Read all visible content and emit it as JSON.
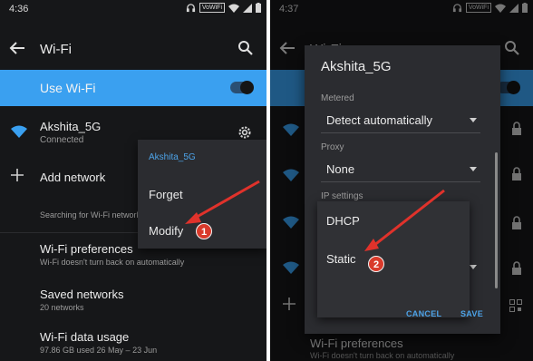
{
  "left": {
    "status": {
      "time": "4:36",
      "badge": "VoWiFi"
    },
    "appbar": {
      "title": "Wi-Fi"
    },
    "use_wifi": {
      "label": "Use Wi-Fi"
    },
    "network": {
      "name": "Akshita_5G",
      "status": "Connected"
    },
    "add_network": {
      "label": "Add network"
    },
    "searching": {
      "text": "Searching for Wi-Fi network"
    },
    "prefs": [
      {
        "title": "Wi-Fi preferences",
        "subtitle": "Wi-Fi doesn't turn back on automatically"
      },
      {
        "title": "Saved networks",
        "subtitle": "20 networks"
      },
      {
        "title": "Wi-Fi data usage",
        "subtitle": "97.86 GB used 26 May – 23 Jun"
      }
    ],
    "popup": {
      "title": "Akshita_5G",
      "items": [
        "Forget",
        "Modify"
      ]
    },
    "callout": "1"
  },
  "right": {
    "status": {
      "time": "4:37",
      "badge": "VoWiFi"
    },
    "appbar": {
      "title": "Wi-Fi"
    },
    "bg_pref": {
      "title": "Wi-Fi preferences",
      "subtitle": "Wi-Fi doesn't turn back on automatically"
    },
    "dialog": {
      "title": "Akshita_5G",
      "metered": {
        "label": "Metered",
        "value": "Detect automatically"
      },
      "proxy": {
        "label": "Proxy",
        "value": "None"
      },
      "ip": {
        "label": "IP settings",
        "options": [
          "DHCP",
          "Static"
        ]
      },
      "cancel": "CANCEL",
      "save": "SAVE"
    },
    "callout": "2"
  },
  "colors": {
    "accent": "#3aa0f0",
    "callout": "#d93a2b",
    "background": "#161719",
    "dialog": "#2b2c30"
  }
}
